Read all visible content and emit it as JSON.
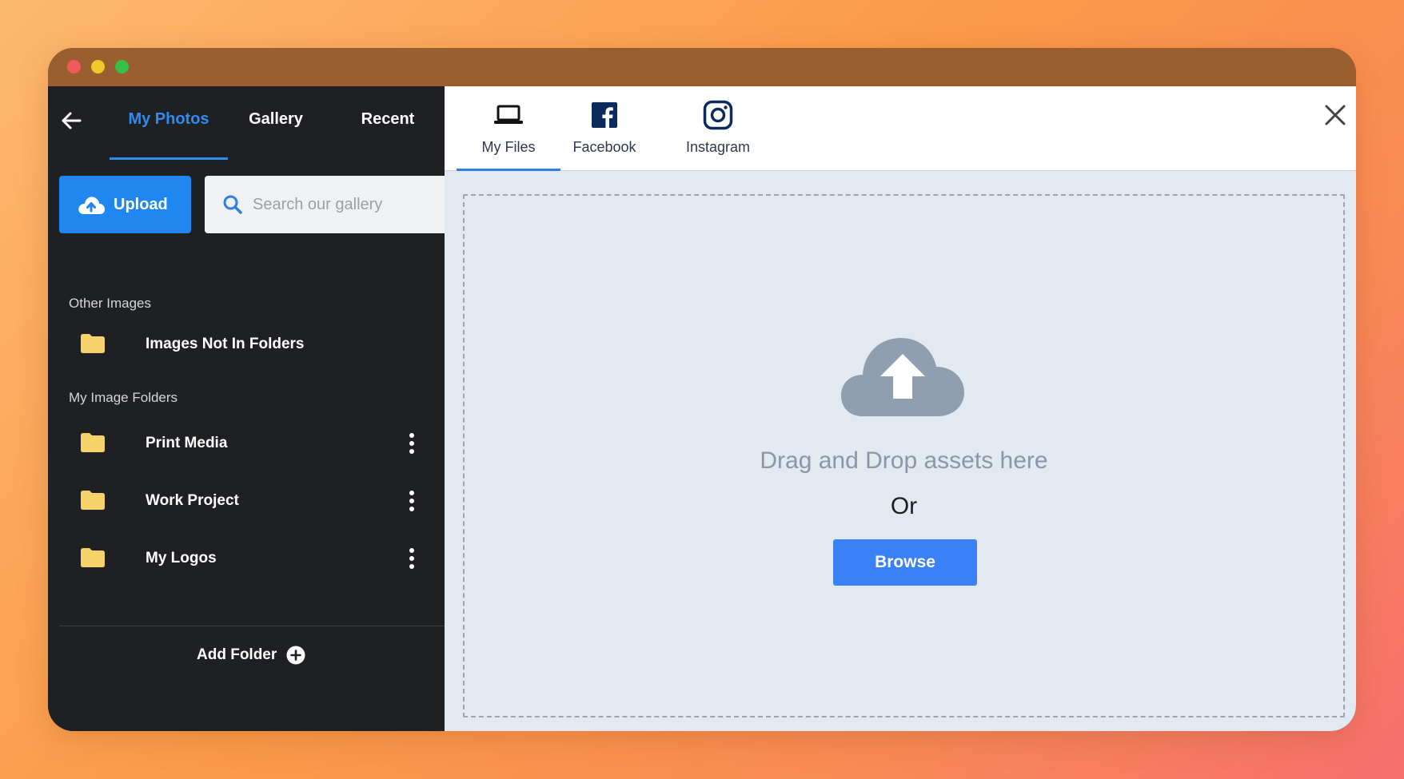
{
  "window": {
    "traffic_lights": [
      "close",
      "minimize",
      "maximize"
    ]
  },
  "sidebar": {
    "back_icon": "arrow-left-icon",
    "tabs": [
      {
        "label": "My Photos",
        "active": true
      },
      {
        "label": "Gallery",
        "active": false
      },
      {
        "label": "Recent",
        "active": false
      }
    ],
    "upload_label": "Upload",
    "upload_icon": "cloud-upload-icon",
    "search": {
      "placeholder": "Search our gallery",
      "value": ""
    },
    "other_images": {
      "heading": "Other Images",
      "items": [
        {
          "label": "Images Not In Folders"
        }
      ]
    },
    "my_folders": {
      "heading": "My Image Folders",
      "items": [
        {
          "label": "Print Media"
        },
        {
          "label": "Work Project"
        },
        {
          "label": "My Logos"
        }
      ]
    },
    "add_folder_label": "Add Folder"
  },
  "main": {
    "source_tabs": [
      {
        "label": "My Files",
        "icon": "laptop-icon",
        "active": true
      },
      {
        "label": "Facebook",
        "icon": "facebook-icon",
        "active": false
      },
      {
        "label": "Instagram",
        "icon": "instagram-icon",
        "active": false
      }
    ],
    "dropzone": {
      "drag_text": "Drag and Drop assets here",
      "or_text": "Or",
      "browse_label": "Browse"
    }
  },
  "colors": {
    "accent": "#2f8bf0",
    "sidebar_bg": "#1f2023",
    "folder": "#f6d26b",
    "browse": "#3a80f6",
    "facebook": "#0d2a5c"
  }
}
